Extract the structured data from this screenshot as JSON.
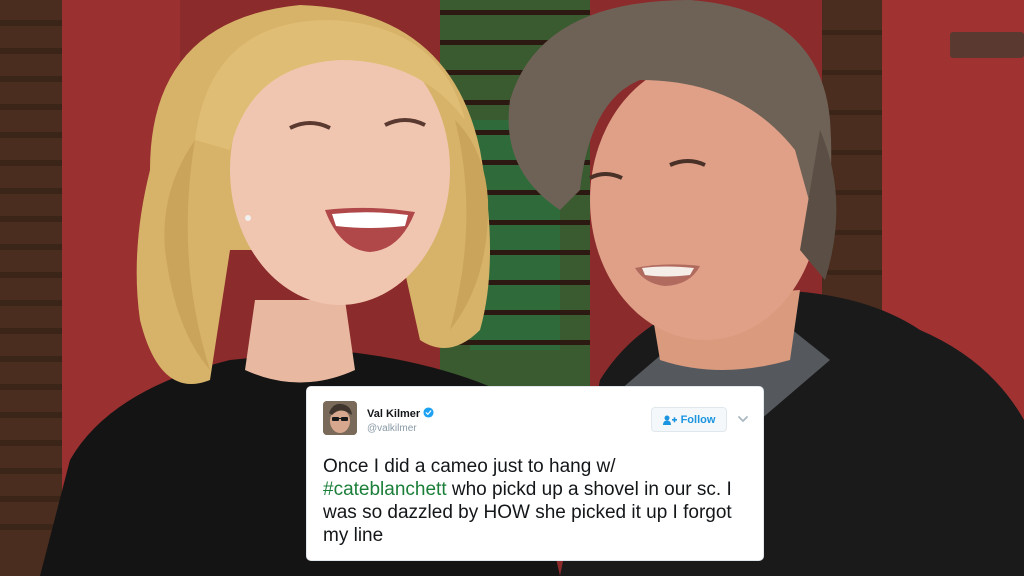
{
  "photo": {
    "description_icon": "photo-of-two-people"
  },
  "tweet": {
    "user_name": "Val Kilmer",
    "user_handle": "@valkilmer",
    "follow_label": "Follow",
    "text_before": "Once I did a cameo just to hang w/",
    "hashtag": "#cateblanchett",
    "text_after": " who pickd up a shovel in our sc. I was so dazzled by HOW she picked it up I forgot my line",
    "verified_icon": "verified-badge-icon",
    "hashtag_color": "#1b7f3a",
    "accent_color": "#1b95e0"
  }
}
